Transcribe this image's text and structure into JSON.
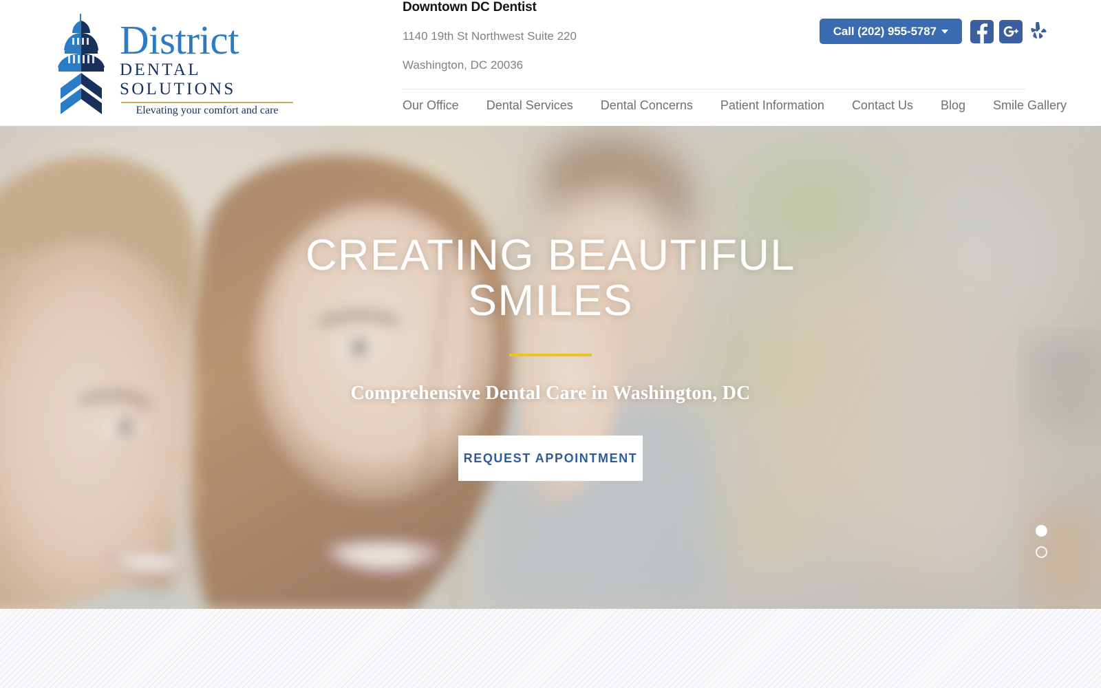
{
  "brand": {
    "name_line1": "District",
    "name_line2": "DENTAL SOLUTIONS",
    "tagline": "Elevating your comfort and care",
    "colors": {
      "logo_blue": "#2b7cc4",
      "logo_navy": "#16315c",
      "logo_gold_rule": "#c6ab5e",
      "button_blue": "#3a6bb0",
      "social_blue": "#3b5f9e",
      "hero_accent_gold": "#e8c61f",
      "cta_text_blue": "#2e5c9a"
    }
  },
  "header": {
    "practice_title": "Downtown DC Dentist",
    "address_line1": "1140 19th St Northwest Suite 220",
    "address_line2": "Washington, DC 20036",
    "call_label": "Call (202) 955-5787",
    "social": [
      {
        "name": "facebook-icon",
        "label": "Facebook"
      },
      {
        "name": "google-plus-icon",
        "label": "Google Plus"
      },
      {
        "name": "yelp-icon",
        "label": "Yelp"
      }
    ]
  },
  "nav": {
    "items": [
      {
        "label": "Our Office"
      },
      {
        "label": "Dental Services"
      },
      {
        "label": "Dental Concerns"
      },
      {
        "label": "Patient Information"
      },
      {
        "label": "Contact Us"
      },
      {
        "label": "Blog"
      },
      {
        "label": "Smile Gallery"
      }
    ]
  },
  "hero": {
    "title": "CREATING BEAUTIFUL SMILES",
    "subtitle": "Comprehensive Dental Care in Washington, DC",
    "cta_label": "REQUEST APPOINTMENT",
    "slides": [
      {
        "state": "active"
      },
      {
        "state": "idle"
      }
    ]
  }
}
